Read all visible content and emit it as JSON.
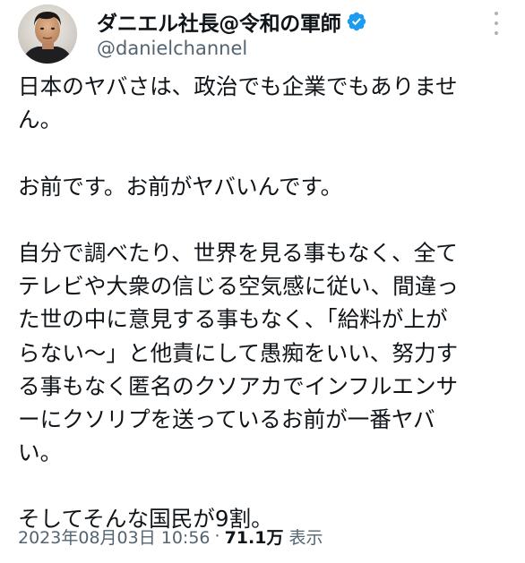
{
  "author": {
    "display_name": "ダニエル社長@令和の軍師",
    "handle": "@danielchannel",
    "verified": true
  },
  "tweet": {
    "lines": [
      "日本のヤバさは、政治でも企業でもありませ",
      "ん。",
      "",
      "お前です。お前がヤバいんです。",
      "",
      "自分で調べたり、世界を見る事もなく、全て",
      "テレビや大衆の信じる空気感に従い、間違っ",
      "た世の中に意見する事もなく、「給料が上が",
      "らない〜」と他責にして愚痴をいい、努力す",
      "る事もなく匿名のクソアカでインフルエンサ",
      "ーにクソリプを送っているお前が一番ヤバ",
      "い。",
      "",
      "そしてそんな国民が9割。"
    ]
  },
  "meta": {
    "timestamp": "2023年08月03日 10:56",
    "separator": "·",
    "views_count": "71.1万",
    "views_label": "表示"
  },
  "icons": {
    "verified": "verified-badge-icon",
    "more": "more-options-icon"
  },
  "colors": {
    "text": "#0f1419",
    "secondary": "#536471",
    "verified": "#1d9bf0"
  }
}
